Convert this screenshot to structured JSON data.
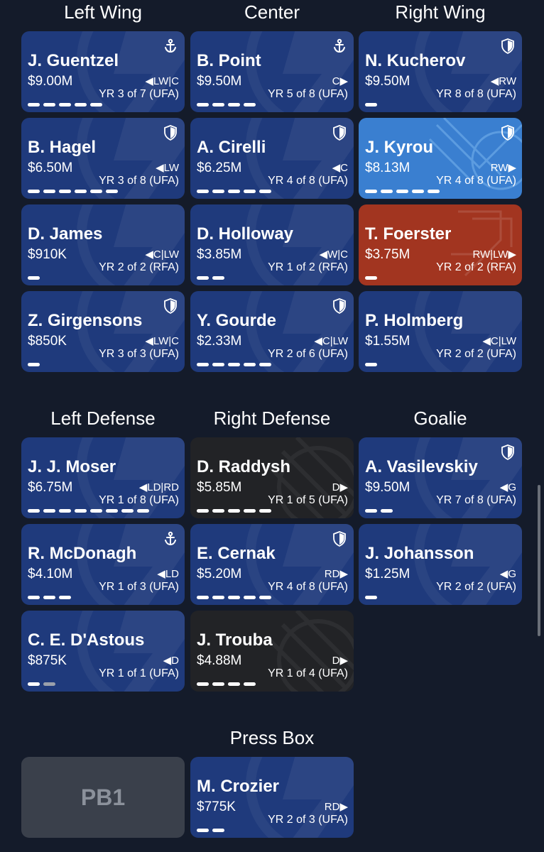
{
  "sections": {
    "left_wing": "Left Wing",
    "center": "Center",
    "right_wing": "Right Wing",
    "left_defense": "Left Defense",
    "right_defense": "Right Defense",
    "goalie": "Goalie",
    "press_box": "Press Box"
  },
  "players": [
    {
      "name": "J. Guentzel",
      "salary": "$9.00M",
      "pos": "◀LW|C",
      "contract": "YR 3 of 7 (UFA)",
      "badge": "anchor",
      "theme": "navy",
      "years_left": 5,
      "dim_years": 0
    },
    {
      "name": "B. Point",
      "salary": "$9.50M",
      "pos": "C▶",
      "contract": "YR 5 of 8 (UFA)",
      "badge": "anchor",
      "theme": "navy",
      "years_left": 4,
      "dim_years": 0
    },
    {
      "name": "N. Kucherov",
      "salary": "$9.50M",
      "pos": "◀RW",
      "contract": "YR 8 of 8 (UFA)",
      "badge": "shield",
      "theme": "navy",
      "years_left": 1,
      "dim_years": 0
    },
    {
      "name": "B. Hagel",
      "salary": "$6.50M",
      "pos": "◀LW",
      "contract": "YR 3 of 8 (UFA)",
      "badge": "shield",
      "theme": "navy",
      "years_left": 6,
      "dim_years": 0
    },
    {
      "name": "A. Cirelli",
      "salary": "$6.25M",
      "pos": "◀C",
      "contract": "YR 4 of 8 (UFA)",
      "badge": "shield",
      "theme": "navy",
      "years_left": 5,
      "dim_years": 0
    },
    {
      "name": "J. Kyrou",
      "salary": "$8.13M",
      "pos": "RW▶",
      "contract": "YR 4 of 8 (UFA)",
      "badge": "shield",
      "theme": "blue",
      "years_left": 5,
      "dim_years": 0
    },
    {
      "name": "D. James",
      "salary": "$910K",
      "pos": "◀C|LW",
      "contract": "YR 2 of 2 (RFA)",
      "badge": "",
      "theme": "navy",
      "years_left": 1,
      "dim_years": 0
    },
    {
      "name": "D. Holloway",
      "salary": "$3.85M",
      "pos": "◀W|C",
      "contract": "YR 1 of 2 (RFA)",
      "badge": "",
      "theme": "navy",
      "years_left": 2,
      "dim_years": 0
    },
    {
      "name": "T. Foerster",
      "salary": "$3.75M",
      "pos": "RW|LW▶",
      "contract": "YR 2 of 2 (RFA)",
      "badge": "",
      "theme": "red",
      "years_left": 1,
      "dim_years": 0
    },
    {
      "name": "Z. Girgensons",
      "salary": "$850K",
      "pos": "◀LW|C",
      "contract": "YR 3 of 3 (UFA)",
      "badge": "shield",
      "theme": "navy",
      "years_left": 1,
      "dim_years": 0
    },
    {
      "name": "Y. Gourde",
      "salary": "$2.33M",
      "pos": "◀C|LW",
      "contract": "YR 2 of 6 (UFA)",
      "badge": "shield",
      "theme": "navy",
      "years_left": 5,
      "dim_years": 0
    },
    {
      "name": "P. Holmberg",
      "salary": "$1.55M",
      "pos": "◀C|LW",
      "contract": "YR 2 of 2 (UFA)",
      "badge": "",
      "theme": "navy",
      "years_left": 1,
      "dim_years": 0
    },
    {
      "name": "J. J. Moser",
      "salary": "$6.75M",
      "pos": "◀LD|RD",
      "contract": "YR 1 of 8 (UFA)",
      "badge": "",
      "theme": "navy",
      "years_left": 8,
      "dim_years": 0
    },
    {
      "name": "D. Raddysh",
      "salary": "$5.85M",
      "pos": "D▶",
      "contract": "YR 1 of 5 (UFA)",
      "badge": "",
      "theme": "black",
      "years_left": 5,
      "dim_years": 0
    },
    {
      "name": "A. Vasilevskiy",
      "salary": "$9.50M",
      "pos": "◀G",
      "contract": "YR 7 of 8 (UFA)",
      "badge": "shield",
      "theme": "navy",
      "years_left": 2,
      "dim_years": 0
    },
    {
      "name": "R. McDonagh",
      "salary": "$4.10M",
      "pos": "◀LD",
      "contract": "YR 1 of 3 (UFA)",
      "badge": "anchor",
      "theme": "navy",
      "years_left": 3,
      "dim_years": 0
    },
    {
      "name": "E. Cernak",
      "salary": "$5.20M",
      "pos": "RD▶",
      "contract": "YR 4 of 8 (UFA)",
      "badge": "shield",
      "theme": "navy",
      "years_left": 5,
      "dim_years": 0
    },
    {
      "name": "J. Johansson",
      "salary": "$1.25M",
      "pos": "◀G",
      "contract": "YR 2 of 2 (UFA)",
      "badge": "",
      "theme": "navy",
      "years_left": 1,
      "dim_years": 0
    },
    {
      "name": "C. E. D'Astous",
      "salary": "$875K",
      "pos": "◀D",
      "contract": "YR 1 of 1 (UFA)",
      "badge": "",
      "theme": "navy",
      "years_left": 1,
      "dim_years": 1
    },
    {
      "name": "J. Trouba",
      "salary": "$4.88M",
      "pos": "D▶",
      "contract": "YR 1 of 4 (UFA)",
      "badge": "",
      "theme": "black",
      "years_left": 4,
      "dim_years": 0
    },
    {
      "name": "M. Crozier",
      "salary": "$775K",
      "pos": "RD▶",
      "contract": "YR 2 of 3 (UFA)",
      "badge": "",
      "theme": "navy",
      "years_left": 2,
      "dim_years": 0
    }
  ],
  "press_box_slot": {
    "label": "PB1"
  },
  "colors": {
    "background": "#141b2a",
    "navy_card": "#1f3a7c",
    "blue_card": "#3a7fd0",
    "red_card": "#a23520",
    "black_card": "#222326",
    "empty_slot": "#3a404b"
  }
}
